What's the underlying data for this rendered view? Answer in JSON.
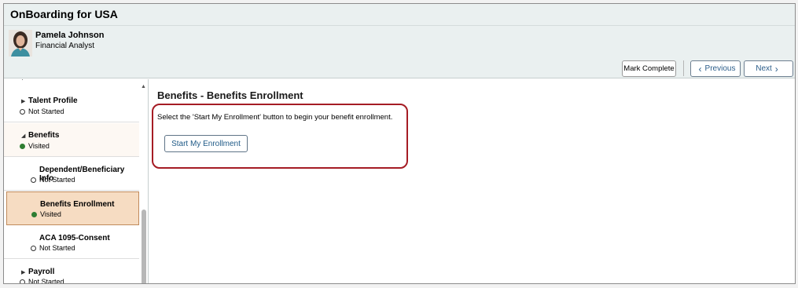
{
  "app": {
    "title": "OnBoarding for USA"
  },
  "user": {
    "name": "Pamela Johnson",
    "title": "Financial Analyst"
  },
  "toolbar": {
    "mark_complete": "Mark Complete",
    "previous": "Previous",
    "next": "Next"
  },
  "sidebar": {
    "items": [
      {
        "label": "Talent Profile",
        "status": "Not Started",
        "state": "not-started"
      },
      {
        "label": "Benefits",
        "status": "Visited",
        "state": "visited"
      },
      {
        "label": "Dependent/Beneficiary Info",
        "status": "Not Started",
        "state": "not-started"
      },
      {
        "label": "Benefits Enrollment",
        "status": "Visited",
        "state": "visited",
        "selected": true
      },
      {
        "label": "ACA 1095-Consent",
        "status": "Not Started",
        "state": "not-started"
      },
      {
        "label": "Payroll",
        "status": "Not Started",
        "state": "not-started"
      }
    ]
  },
  "main": {
    "title": "Benefits - Benefits Enrollment",
    "instruction": "Select the 'Start My Enrollment' button to begin your benefit enrollment.",
    "start_button": "Start My Enrollment"
  },
  "colors": {
    "header_bg": "#eaf0f0",
    "selected_bg": "#f6dcc2",
    "visited_dot": "#2e7d32",
    "highlight_border": "#a51c24",
    "link_blue": "#2b5d8a"
  }
}
